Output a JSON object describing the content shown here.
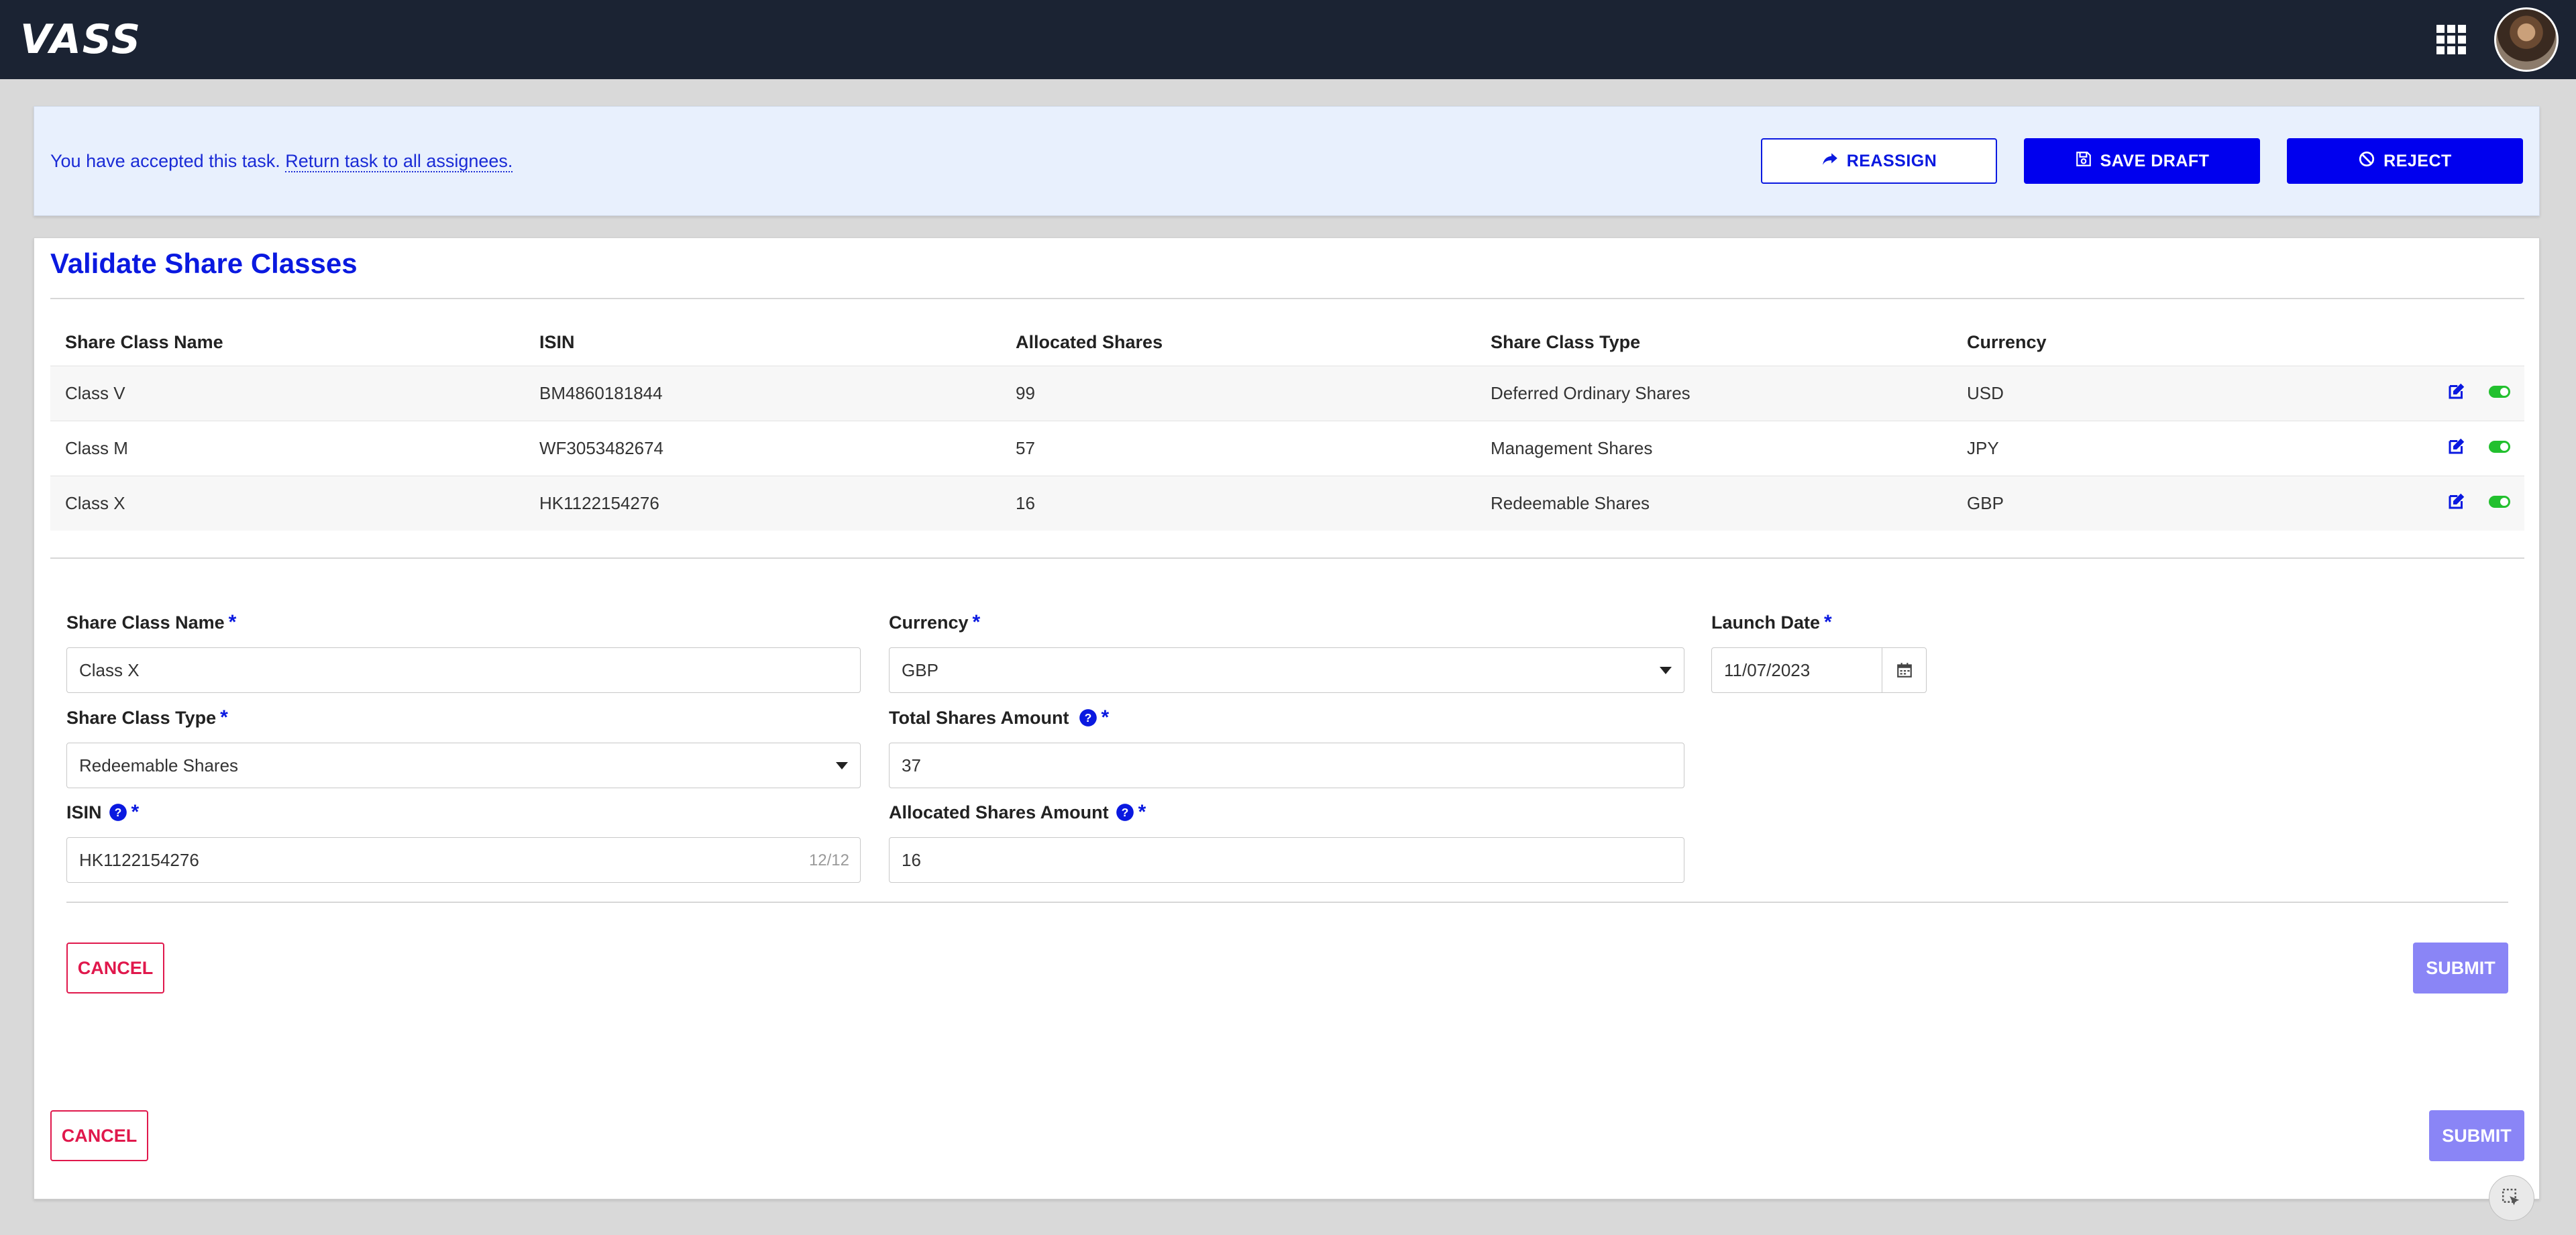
{
  "header": {
    "logo": "VASS",
    "apps_icon": "apps-grid-icon",
    "avatar_icon": "user-avatar"
  },
  "banner": {
    "message": "You have accepted this task.",
    "link": "Return task to all assignees.",
    "reassign_label": "REASSIGN",
    "save_draft_label": "SAVE DRAFT",
    "reject_label": "REJECT"
  },
  "page": {
    "title": "Validate Share Classes"
  },
  "table": {
    "columns": [
      "Share Class Name",
      "ISIN",
      "Allocated Shares",
      "Share Class Type",
      "Currency"
    ],
    "rows": [
      {
        "name": "Class V",
        "isin": "BM4860181844",
        "allocated": "99",
        "type": "Deferred Ordinary Shares",
        "currency": "USD"
      },
      {
        "name": "Class M",
        "isin": "WF3053482674",
        "allocated": "57",
        "type": "Management Shares",
        "currency": "JPY"
      },
      {
        "name": "Class X",
        "isin": "HK1122154276",
        "allocated": "16",
        "type": "Redeemable Shares",
        "currency": "GBP"
      }
    ]
  },
  "form": {
    "share_class_name": {
      "label": "Share Class Name",
      "value": "Class X"
    },
    "currency": {
      "label": "Currency",
      "value": "GBP"
    },
    "launch_date": {
      "label": "Launch Date",
      "value": "11/07/2023"
    },
    "share_class_type": {
      "label": "Share Class Type",
      "value": "Redeemable Shares"
    },
    "total_shares_amount": {
      "label": "Total Shares Amount",
      "value": "37"
    },
    "isin": {
      "label": "ISIN",
      "value": "HK1122154276",
      "counter": "12/12"
    },
    "allocated_shares_amount": {
      "label": "Allocated Shares Amount",
      "value": "16"
    },
    "required_mark": "*",
    "cancel_label": "CANCEL",
    "submit_label": "SUBMIT"
  },
  "footer": {
    "cancel_label": "CANCEL",
    "submit_label": "SUBMIT"
  },
  "colors": {
    "primary_blue": "#0000ee",
    "danger": "#e0184c",
    "submit_disabled": "#8a85f6",
    "header_bg": "#1b2333",
    "banner_bg": "#e8f0fd",
    "toggle_on": "#22c02e"
  }
}
